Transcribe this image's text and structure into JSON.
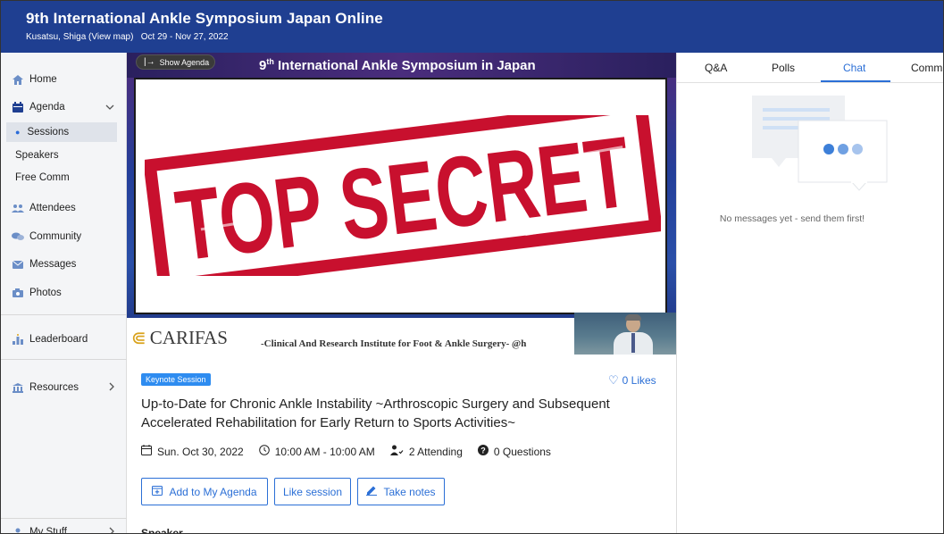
{
  "header": {
    "title": "9th International Ankle Symposium Japan Online",
    "location": "Kusatsu, Shiga",
    "map_link": "(View map)",
    "dates": "Oct 29 - Nov 27, 2022"
  },
  "sidebar": {
    "items": [
      {
        "label": "Home",
        "icon": "home-icon"
      },
      {
        "label": "Agenda",
        "icon": "calendar-icon"
      },
      {
        "label": "Sessions"
      },
      {
        "label": "Speakers"
      },
      {
        "label": "Free Comm"
      },
      {
        "label": "Attendees",
        "icon": "people-icon"
      },
      {
        "label": "Community",
        "icon": "chat-bubbles-icon"
      },
      {
        "label": "Messages",
        "icon": "envelope-icon"
      },
      {
        "label": "Photos",
        "icon": "camera-icon"
      },
      {
        "label": "Leaderboard",
        "icon": "leaderboard-icon"
      },
      {
        "label": "Resources",
        "icon": "building-icon"
      },
      {
        "label": "My Stuff",
        "icon": "person-icon"
      }
    ]
  },
  "video": {
    "show_agenda": "Show Agenda",
    "banner_title_prefix": "9",
    "banner_title_sup": "th",
    "banner_title_rest": " International Ankle Symposium in Japan",
    "stamp_text": "TOP SECRET",
    "logo_text": "CARIFAS",
    "logo_subtitle": "-Clinical And Research Institute for Foot & Ankle Surgery-  @h"
  },
  "session": {
    "badge": "Keynote Session",
    "likes": "0 Likes",
    "title": "Up-to-Date for Chronic Ankle Instability ~Arthroscopic Surgery and Subsequent Accelerated Rehabilitation for Early Return to Sports Activities~",
    "date": "Sun. Oct 30, 2022",
    "time": "10:00 AM - 10:00 AM",
    "attending": "2 Attending",
    "questions": "0 Questions",
    "buttons": {
      "add_agenda": "Add to My Agenda",
      "like": "Like session",
      "notes": "Take notes"
    },
    "speaker_heading": "Speaker"
  },
  "right_panel": {
    "tabs": [
      "Q&A",
      "Polls",
      "Chat",
      "Communi"
    ],
    "active_tab": "Chat",
    "empty_message": "No messages yet - send them first!"
  },
  "colors": {
    "header_bg": "#1f3f91",
    "accent": "#2b6fd6",
    "stamp_red": "#c8102e",
    "badge_bg": "#2e8cf0"
  }
}
